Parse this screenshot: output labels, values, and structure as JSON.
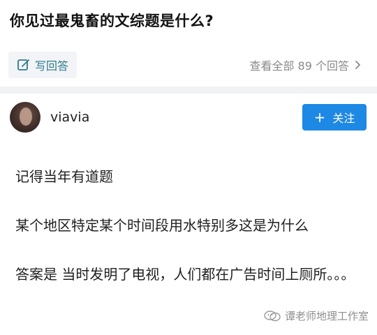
{
  "question": {
    "title": "你见过最鬼畜的文综题是什么?"
  },
  "actions": {
    "write_answer_label": "写回答",
    "view_all_label": "查看全部 89 个回答"
  },
  "author": {
    "name": "viavia",
    "follow_label": "关注"
  },
  "answer": {
    "paragraphs": [
      "记得当年有道题",
      "某个地区特定某个时间段用水特别多这是为什么",
      "答案是 当时发明了电视，人们都在广告时间上厕所。。。"
    ]
  },
  "watermark": {
    "text": "谭老师地理工作室"
  },
  "colors": {
    "accent_blue": "#1e88e5",
    "write_answer_teal": "#2d7b8c",
    "muted_gray": "#8a8a8a",
    "divider_gray": "#f1f2f4"
  },
  "icons": {
    "write": "edit-pencil-icon",
    "chevron": "chevron-right-icon",
    "follow": "plus-icon",
    "watermark": "wechat-logo-icon"
  }
}
